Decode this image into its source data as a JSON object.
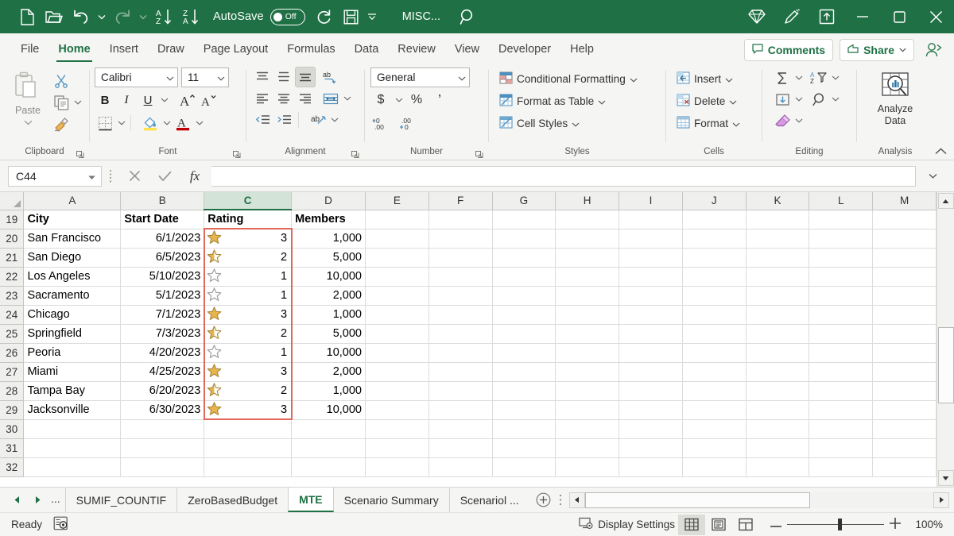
{
  "titlebar": {
    "quick_access": [
      {
        "name": "new-file-icon",
        "label": "New"
      },
      {
        "name": "open-folder-icon",
        "label": "Open"
      },
      {
        "name": "undo-icon",
        "label": "Undo"
      },
      {
        "name": "redo-icon",
        "label": "Redo"
      },
      {
        "name": "sort-ascending-icon",
        "label": "Sort A to Z"
      },
      {
        "name": "sort-descending-icon",
        "label": "Sort Z to A"
      }
    ],
    "autosave_label": "AutoSave",
    "autosave_state": "Off",
    "refresh_label": "Refresh",
    "save_label": "Save",
    "customize_label": "Customize Quick Access Toolbar",
    "file_title": "MISC...",
    "search_label": "Search",
    "diamond_label": "Microsoft 365",
    "ink_label": "Ink",
    "ribbon_display_label": "Ribbon Display Options",
    "minimize_label": "Minimize",
    "maximize_label": "Maximize",
    "close_label": "Close",
    "accent_color": "#1F7145"
  },
  "ribbon_tabs": [
    {
      "label": "File",
      "active": false
    },
    {
      "label": "Home",
      "active": true
    },
    {
      "label": "Insert",
      "active": false
    },
    {
      "label": "Draw",
      "active": false
    },
    {
      "label": "Page Layout",
      "active": false
    },
    {
      "label": "Formulas",
      "active": false
    },
    {
      "label": "Data",
      "active": false
    },
    {
      "label": "Review",
      "active": false
    },
    {
      "label": "View",
      "active": false
    },
    {
      "label": "Developer",
      "active": false
    },
    {
      "label": "Help",
      "active": false
    }
  ],
  "tab_right": {
    "comments_label": "Comments",
    "share_label": "Share",
    "person_label": "Share with people"
  },
  "ribbon": {
    "clipboard": {
      "group_label": "Clipboard",
      "paste_label": "Paste",
      "cut_label": "Cut",
      "copy_label": "Copy",
      "format_painter_label": "Format Painter"
    },
    "font": {
      "group_label": "Font",
      "font_family": "Calibri",
      "font_size": "11",
      "bold_label": "B",
      "italic_label": "I",
      "underline_label": "U",
      "grow_font_label": "Increase Font Size",
      "shrink_font_label": "Decrease Font Size",
      "borders_label": "Borders",
      "fill_color_label": "Fill Color",
      "font_color_label": "Font Color"
    },
    "alignment": {
      "group_label": "Alignment",
      "top_align_label": "Top Align",
      "middle_align_label": "Middle Align",
      "bottom_align_label": "Bottom Align",
      "orientation_label": "Orientation",
      "align_left_label": "Align Left",
      "align_center_label": "Center",
      "align_right_label": "Align Right",
      "wrap_text_label": "Wrap Text",
      "decrease_indent_label": "Decrease Indent",
      "increase_indent_label": "Increase Indent",
      "merge_label": "Merge & Center"
    },
    "number": {
      "group_label": "Number",
      "format": "General",
      "accounting_label": "Accounting Number Format",
      "percent_label": "Percent Style",
      "comma_label": "Comma Style",
      "increase_decimal_label": "Increase Decimal",
      "decrease_decimal_label": "Decrease Decimal"
    },
    "styles": {
      "group_label": "Styles",
      "items": [
        {
          "label": "Conditional Formatting",
          "icon": "conditional-formatting-icon"
        },
        {
          "label": "Format as Table",
          "icon": "format-as-table-icon"
        },
        {
          "label": "Cell Styles",
          "icon": "cell-styles-icon"
        }
      ]
    },
    "cells": {
      "group_label": "Cells",
      "items": [
        {
          "label": "Insert",
          "icon": "insert-cells-icon"
        },
        {
          "label": "Delete",
          "icon": "delete-cells-icon"
        },
        {
          "label": "Format",
          "icon": "format-cells-icon"
        }
      ]
    },
    "editing": {
      "group_label": "Editing",
      "autosum_label": "AutoSum",
      "sort_filter_label": "Sort & Filter",
      "fill_label": "Fill",
      "find_select_label": "Find & Select",
      "clear_label": "Clear"
    },
    "analysis": {
      "group_label": "Analysis",
      "analyze_line1": "Analyze",
      "analyze_line2": "Data"
    },
    "collapse_label": "Collapse the Ribbon"
  },
  "formula_bar": {
    "name_box_value": "C44",
    "cancel_label": "Cancel",
    "enter_label": "Enter",
    "insert_function_label": "fx",
    "formula_value": "",
    "expand_label": "Expand Formula Bar"
  },
  "grid": {
    "columns": [
      {
        "label": "A",
        "width": 122,
        "selected": false
      },
      {
        "label": "B",
        "width": 105,
        "selected": false
      },
      {
        "label": "C",
        "width": 110,
        "selected": true
      },
      {
        "label": "D",
        "width": 93,
        "selected": false
      },
      {
        "label": "E",
        "width": 80,
        "selected": false
      },
      {
        "label": "F",
        "width": 80,
        "selected": false
      },
      {
        "label": "G",
        "width": 80,
        "selected": false
      },
      {
        "label": "H",
        "width": 80,
        "selected": false
      },
      {
        "label": "I",
        "width": 80,
        "selected": false
      },
      {
        "label": "J",
        "width": 80,
        "selected": false
      },
      {
        "label": "K",
        "width": 80,
        "selected": false
      },
      {
        "label": "L",
        "width": 80,
        "selected": false
      },
      {
        "label": "M",
        "width": 80,
        "selected": false
      }
    ],
    "rows": [
      {
        "num": "19",
        "cells": [
          {
            "v": "City",
            "bold": true,
            "align": "left"
          },
          {
            "v": "Start Date",
            "bold": true,
            "align": "left"
          },
          {
            "v": "Rating",
            "bold": true,
            "align": "left"
          },
          {
            "v": "Members",
            "bold": true,
            "align": "left"
          }
        ]
      },
      {
        "num": "20",
        "cells": [
          {
            "v": "San Francisco",
            "align": "left"
          },
          {
            "v": "6/1/2023",
            "align": "right"
          },
          {
            "v": "3",
            "align": "right",
            "star": "full"
          },
          {
            "v": "1,000",
            "align": "right"
          }
        ]
      },
      {
        "num": "21",
        "cells": [
          {
            "v": "San Diego",
            "align": "left"
          },
          {
            "v": "6/5/2023",
            "align": "right"
          },
          {
            "v": "2",
            "align": "right",
            "star": "half"
          },
          {
            "v": "5,000",
            "align": "right"
          }
        ]
      },
      {
        "num": "22",
        "cells": [
          {
            "v": "Los Angeles",
            "align": "left"
          },
          {
            "v": "5/10/2023",
            "align": "right"
          },
          {
            "v": "1",
            "align": "right",
            "star": "empty"
          },
          {
            "v": "10,000",
            "align": "right"
          }
        ]
      },
      {
        "num": "23",
        "cells": [
          {
            "v": "Sacramento",
            "align": "left"
          },
          {
            "v": "5/1/2023",
            "align": "right"
          },
          {
            "v": "1",
            "align": "right",
            "star": "empty"
          },
          {
            "v": "2,000",
            "align": "right"
          }
        ]
      },
      {
        "num": "24",
        "cells": [
          {
            "v": "Chicago",
            "align": "left"
          },
          {
            "v": "7/1/2023",
            "align": "right"
          },
          {
            "v": "3",
            "align": "right",
            "star": "full"
          },
          {
            "v": "1,000",
            "align": "right"
          }
        ]
      },
      {
        "num": "25",
        "cells": [
          {
            "v": "Springfield",
            "align": "left"
          },
          {
            "v": "7/3/2023",
            "align": "right"
          },
          {
            "v": "2",
            "align": "right",
            "star": "half"
          },
          {
            "v": "5,000",
            "align": "right"
          }
        ]
      },
      {
        "num": "26",
        "cells": [
          {
            "v": "Peoria",
            "align": "left"
          },
          {
            "v": "4/20/2023",
            "align": "right"
          },
          {
            "v": "1",
            "align": "right",
            "star": "empty"
          },
          {
            "v": "10,000",
            "align": "right"
          }
        ]
      },
      {
        "num": "27",
        "cells": [
          {
            "v": "Miami",
            "align": "left"
          },
          {
            "v": "4/25/2023",
            "align": "right"
          },
          {
            "v": "3",
            "align": "right",
            "star": "full"
          },
          {
            "v": "2,000",
            "align": "right"
          }
        ]
      },
      {
        "num": "28",
        "cells": [
          {
            "v": "Tampa Bay",
            "align": "left"
          },
          {
            "v": "6/20/2023",
            "align": "right"
          },
          {
            "v": "2",
            "align": "right",
            "star": "half"
          },
          {
            "v": "1,000",
            "align": "right"
          }
        ]
      },
      {
        "num": "29",
        "cells": [
          {
            "v": "Jacksonville",
            "align": "left"
          },
          {
            "v": "6/30/2023",
            "align": "right"
          },
          {
            "v": "3",
            "align": "right",
            "star": "full"
          },
          {
            "v": "10,000",
            "align": "right"
          }
        ]
      },
      {
        "num": "30",
        "cells": [
          {
            "v": ""
          },
          {
            "v": ""
          },
          {
            "v": ""
          },
          {
            "v": ""
          }
        ]
      },
      {
        "num": "31",
        "cells": [
          {
            "v": ""
          },
          {
            "v": ""
          },
          {
            "v": ""
          },
          {
            "v": ""
          }
        ]
      },
      {
        "num": "32",
        "cells": [
          {
            "v": ""
          },
          {
            "v": ""
          },
          {
            "v": ""
          },
          {
            "v": ""
          }
        ]
      }
    ],
    "selection_border_color": "#E0675A",
    "star_full_color": "#E8B44C",
    "star_outline_color": "#9B9B9B"
  },
  "sheet_tabs": {
    "first_label": "First Sheet",
    "prev_label": "Previous Sheet",
    "overflow_label": "...",
    "tabs": [
      {
        "label": "SUMIF_COUNTIF",
        "active": false
      },
      {
        "label": "ZeroBasedBudget",
        "active": false
      },
      {
        "label": "MTE",
        "active": true
      },
      {
        "label": "Scenario Summary",
        "active": false
      },
      {
        "label": "Scenariol ...",
        "active": false
      }
    ],
    "add_label": "New sheet",
    "menu_label": "Sheet options"
  },
  "status_bar": {
    "ready_label": "Ready",
    "accessibility_label": "Accessibility Checker",
    "display_settings_label": "Display Settings",
    "view_normal_label": "Normal",
    "view_pagelayout_label": "Page Layout",
    "view_pagebreak_label": "Page Break Preview",
    "zoom_out_label": "Zoom Out",
    "zoom_in_label": "Zoom In",
    "zoom_value": "100%"
  }
}
